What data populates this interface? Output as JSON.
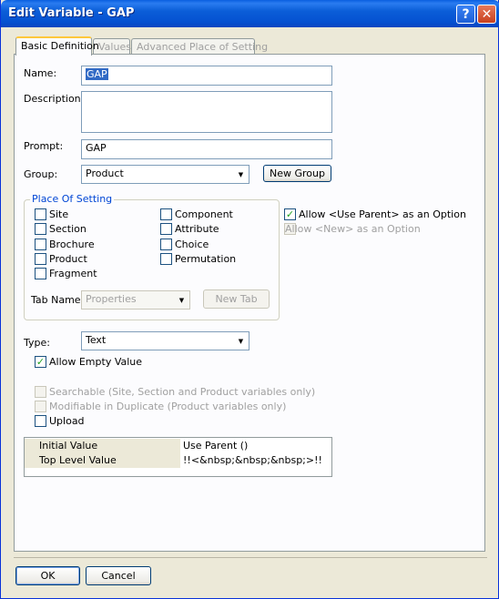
{
  "window": {
    "title": "Edit Variable - GAP",
    "help_label": "?",
    "close_label": "✕"
  },
  "tabs": [
    {
      "label": "Basic Definition",
      "active": true
    },
    {
      "label": "Values",
      "active": false
    },
    {
      "label": "Advanced Place of Setting",
      "active": false
    }
  ],
  "form": {
    "name_label": "Name:",
    "name_value": "GAP",
    "description_label": "Description:",
    "description_value": "",
    "prompt_label": "Prompt:",
    "prompt_value": "GAP",
    "group_label": "Group:",
    "group_value": "Product",
    "new_group_button": "New Group"
  },
  "place_of_setting": {
    "title": "Place Of Setting",
    "left_items": [
      {
        "label": "Site",
        "checked": false
      },
      {
        "label": "Section",
        "checked": false
      },
      {
        "label": "Brochure",
        "checked": false
      },
      {
        "label": "Product",
        "checked": false
      },
      {
        "label": "Fragment",
        "checked": false
      }
    ],
    "right_items": [
      {
        "label": "Component",
        "checked": false
      },
      {
        "label": "Attribute",
        "checked": false
      },
      {
        "label": "Choice",
        "checked": false
      },
      {
        "label": "Permutation",
        "checked": false
      }
    ],
    "tab_name_label": "Tab Name:",
    "tab_name_value": "Properties",
    "new_tab_button": "New Tab"
  },
  "options": {
    "allow_use_parent": {
      "label": "Allow <Use Parent> as an Option",
      "checked": true
    },
    "allow_new": {
      "label": "Allow <New> as an Option",
      "checked": false,
      "disabled": true
    }
  },
  "type_section": {
    "type_label": "Type:",
    "type_value": "Text",
    "allow_empty": {
      "label": "Allow Empty Value",
      "checked": true
    },
    "searchable": {
      "label": "Searchable (Site, Section and Product variables only)",
      "checked": false,
      "disabled": true
    },
    "modifiable": {
      "label": "Modifiable in Duplicate (Product variables only)",
      "checked": false,
      "disabled": true
    },
    "upload": {
      "label": "Upload",
      "checked": false
    }
  },
  "values_grid": [
    {
      "key": "Initial Value",
      "value": "Use Parent ()"
    },
    {
      "key": "Top Level Value",
      "value": "!!<&nbsp;&nbsp;&nbsp;>!!"
    }
  ],
  "footer": {
    "ok_button": "OK",
    "cancel_button": "Cancel"
  },
  "colors": {
    "titlebar": "#0b5ed8",
    "dialog_bg": "#ece9d8",
    "group_title": "#0046d5",
    "check_mark": "#21a121"
  }
}
